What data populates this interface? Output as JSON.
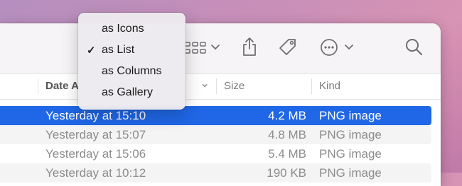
{
  "view_menu": {
    "items": [
      {
        "label": "as Icons",
        "checked": false
      },
      {
        "label": "as List",
        "checked": true
      },
      {
        "label": "as Columns",
        "checked": false
      },
      {
        "label": "as Gallery",
        "checked": false
      }
    ],
    "check_glyph": "✓"
  },
  "toolbar": {
    "icons": [
      "view-options-grid-icon",
      "chevron-down-icon",
      "share-icon",
      "tag-icon",
      "more-actions-icon",
      "chevron-down-icon",
      "search-icon"
    ]
  },
  "columns": {
    "date": "Date A",
    "size": "Size",
    "kind": "Kind",
    "sort_glyph": "⌄"
  },
  "rows": [
    {
      "date": "Yesterday at 15:10",
      "size": "4.2 MB",
      "kind": "PNG image",
      "selected": true
    },
    {
      "date": "Yesterday at 15:07",
      "size": "4.8 MB",
      "kind": "PNG image",
      "selected": false
    },
    {
      "date": "Yesterday at 15:06",
      "size": "5.4 MB",
      "kind": "PNG image",
      "selected": false
    },
    {
      "date": "Yesterday at 10:12",
      "size": "190 KB",
      "kind": "PNG image",
      "selected": false
    }
  ],
  "colors": {
    "selection": "#1f67e6",
    "desktop": "#c98fb8"
  }
}
